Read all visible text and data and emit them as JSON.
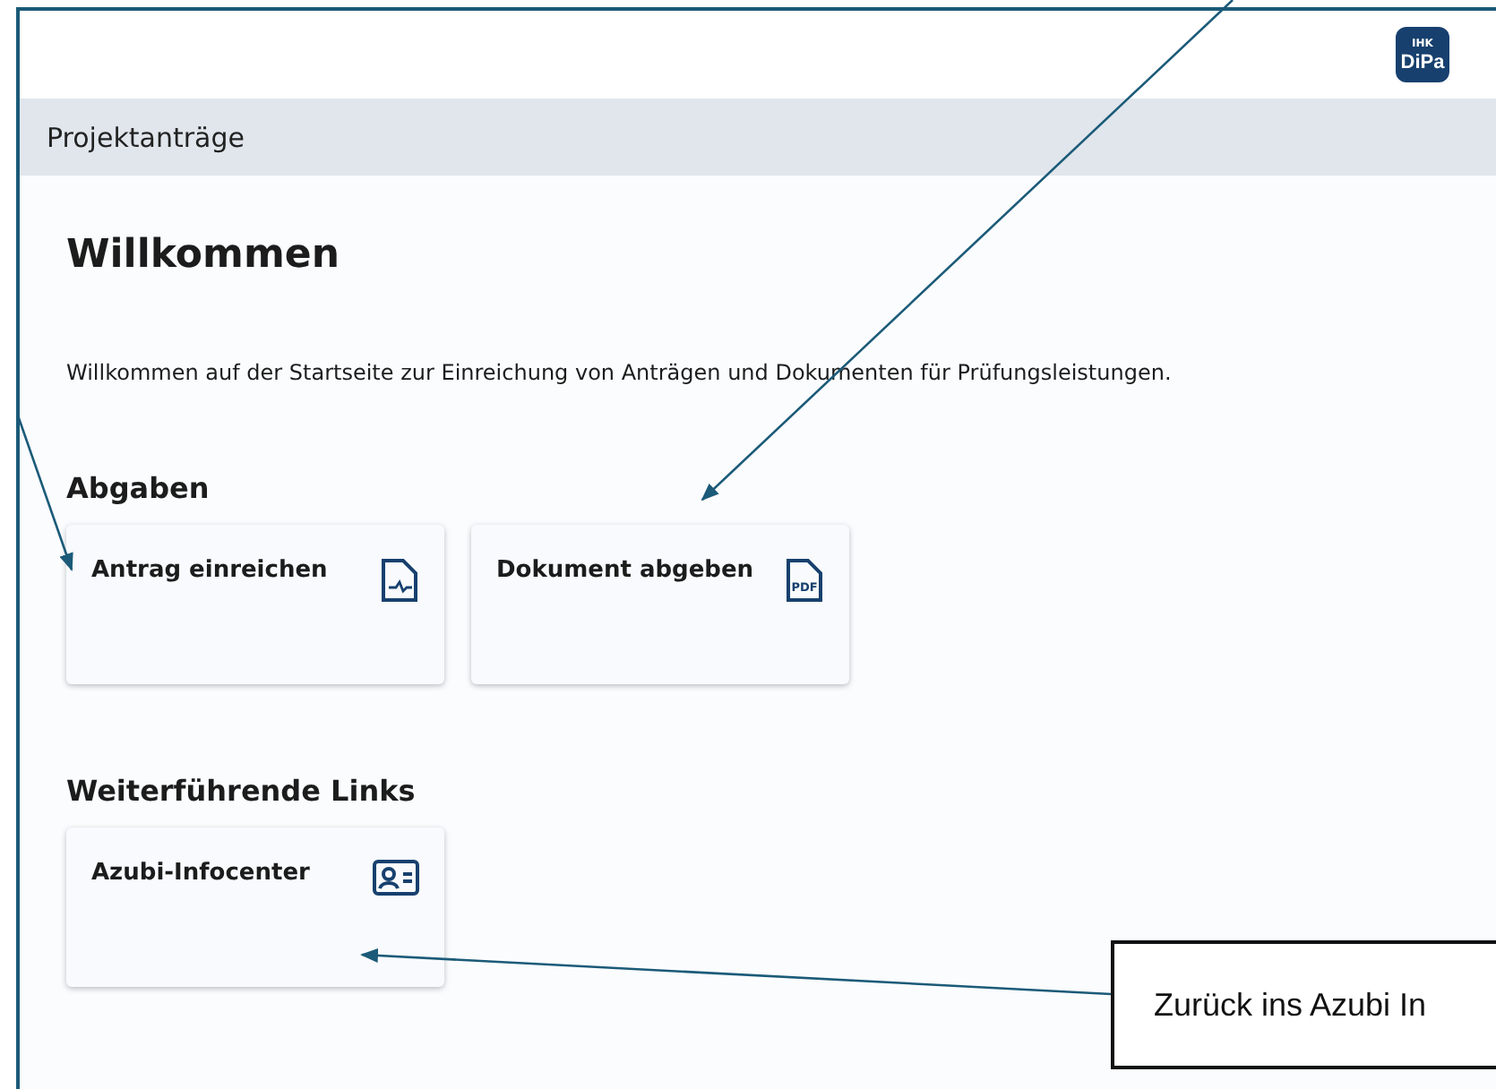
{
  "logo": {
    "top": "IHK",
    "bottom": "DiPa"
  },
  "subheader": {
    "title": "Projektanträge"
  },
  "page": {
    "title": "Willkommen",
    "intro": "Willkommen auf der Startseite zur Einreichung von Anträgen und Dokumenten für Prüfungsleistungen."
  },
  "sections": [
    {
      "title": "Abgaben",
      "cards": [
        {
          "label": "Antrag einreichen",
          "kind": "signature"
        },
        {
          "label": "Dokument abgeben",
          "kind": "pdf",
          "icon_label": "PDF"
        }
      ]
    },
    {
      "title": "Weiterführende Links",
      "cards": [
        {
          "label": "Azubi-Infocenter",
          "kind": "contact"
        }
      ]
    }
  ],
  "callout": {
    "text": "Zurück ins Azubi In"
  }
}
